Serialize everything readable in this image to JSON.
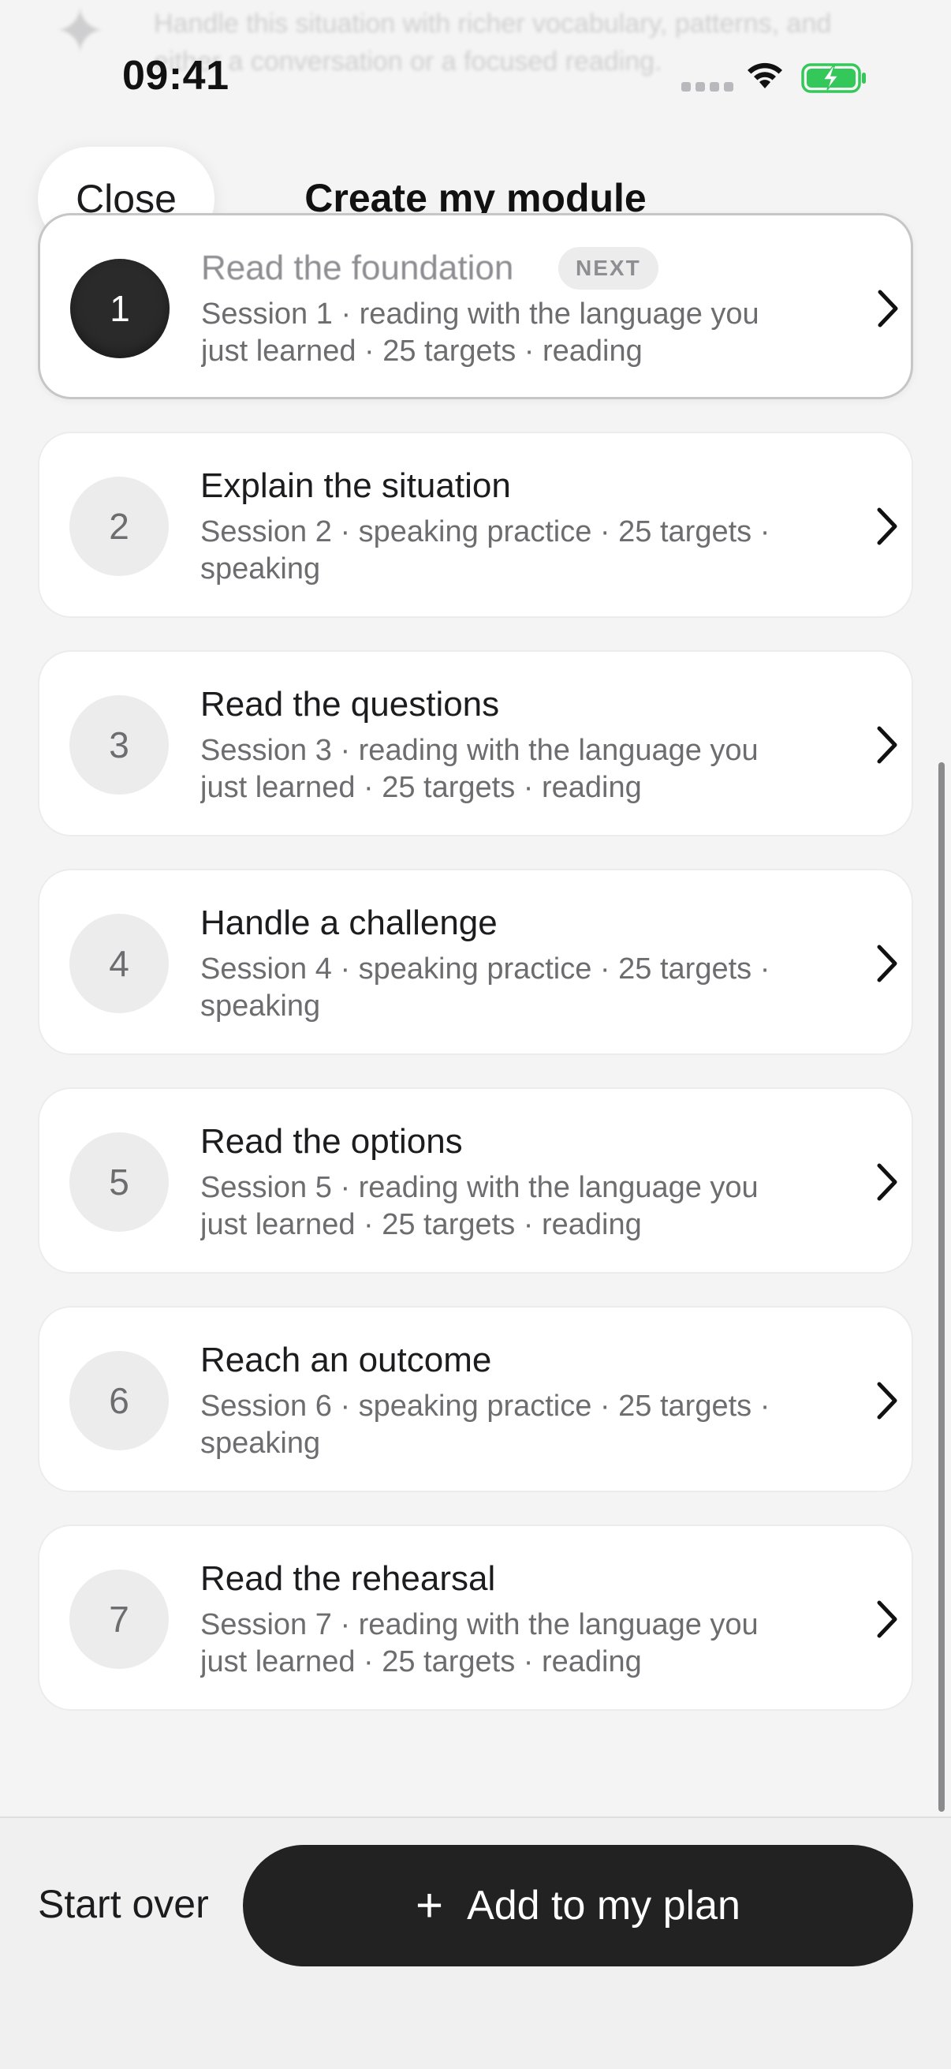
{
  "background": {
    "hint_text": "Handle this situation with richer vocabulary, patterns, and either a conversation or a focused reading."
  },
  "status_bar": {
    "time": "09:41"
  },
  "header": {
    "close_label": "Close",
    "title": "Create my module"
  },
  "sessions": [
    {
      "number": "1",
      "title": "Read the foundation",
      "badge": "NEXT",
      "subtitle": "Session 1 · reading with the language you just learned · 25 targets · reading"
    },
    {
      "number": "2",
      "title": "Explain the situation",
      "subtitle": "Session 2 · speaking practice · 25 targets · speaking"
    },
    {
      "number": "3",
      "title": "Read the questions",
      "subtitle": "Session 3 · reading with the language you just learned · 25 targets · reading"
    },
    {
      "number": "4",
      "title": "Handle a challenge",
      "subtitle": "Session 4 · speaking practice · 25 targets · speaking"
    },
    {
      "number": "5",
      "title": "Read the options",
      "subtitle": "Session 5 · reading with the language you just learned · 25 targets · reading"
    },
    {
      "number": "6",
      "title": "Reach an outcome",
      "subtitle": "Session 6 · speaking practice · 25 targets · speaking"
    },
    {
      "number": "7",
      "title": "Read the rehearsal",
      "subtitle": "Session 7 · reading with the language you just learned · 25 targets · reading"
    }
  ],
  "footer": {
    "start_over_label": "Start over",
    "add_label": "Add to my plan"
  },
  "colors": {
    "primary_button": "#222222",
    "battery_green": "#34c759"
  }
}
